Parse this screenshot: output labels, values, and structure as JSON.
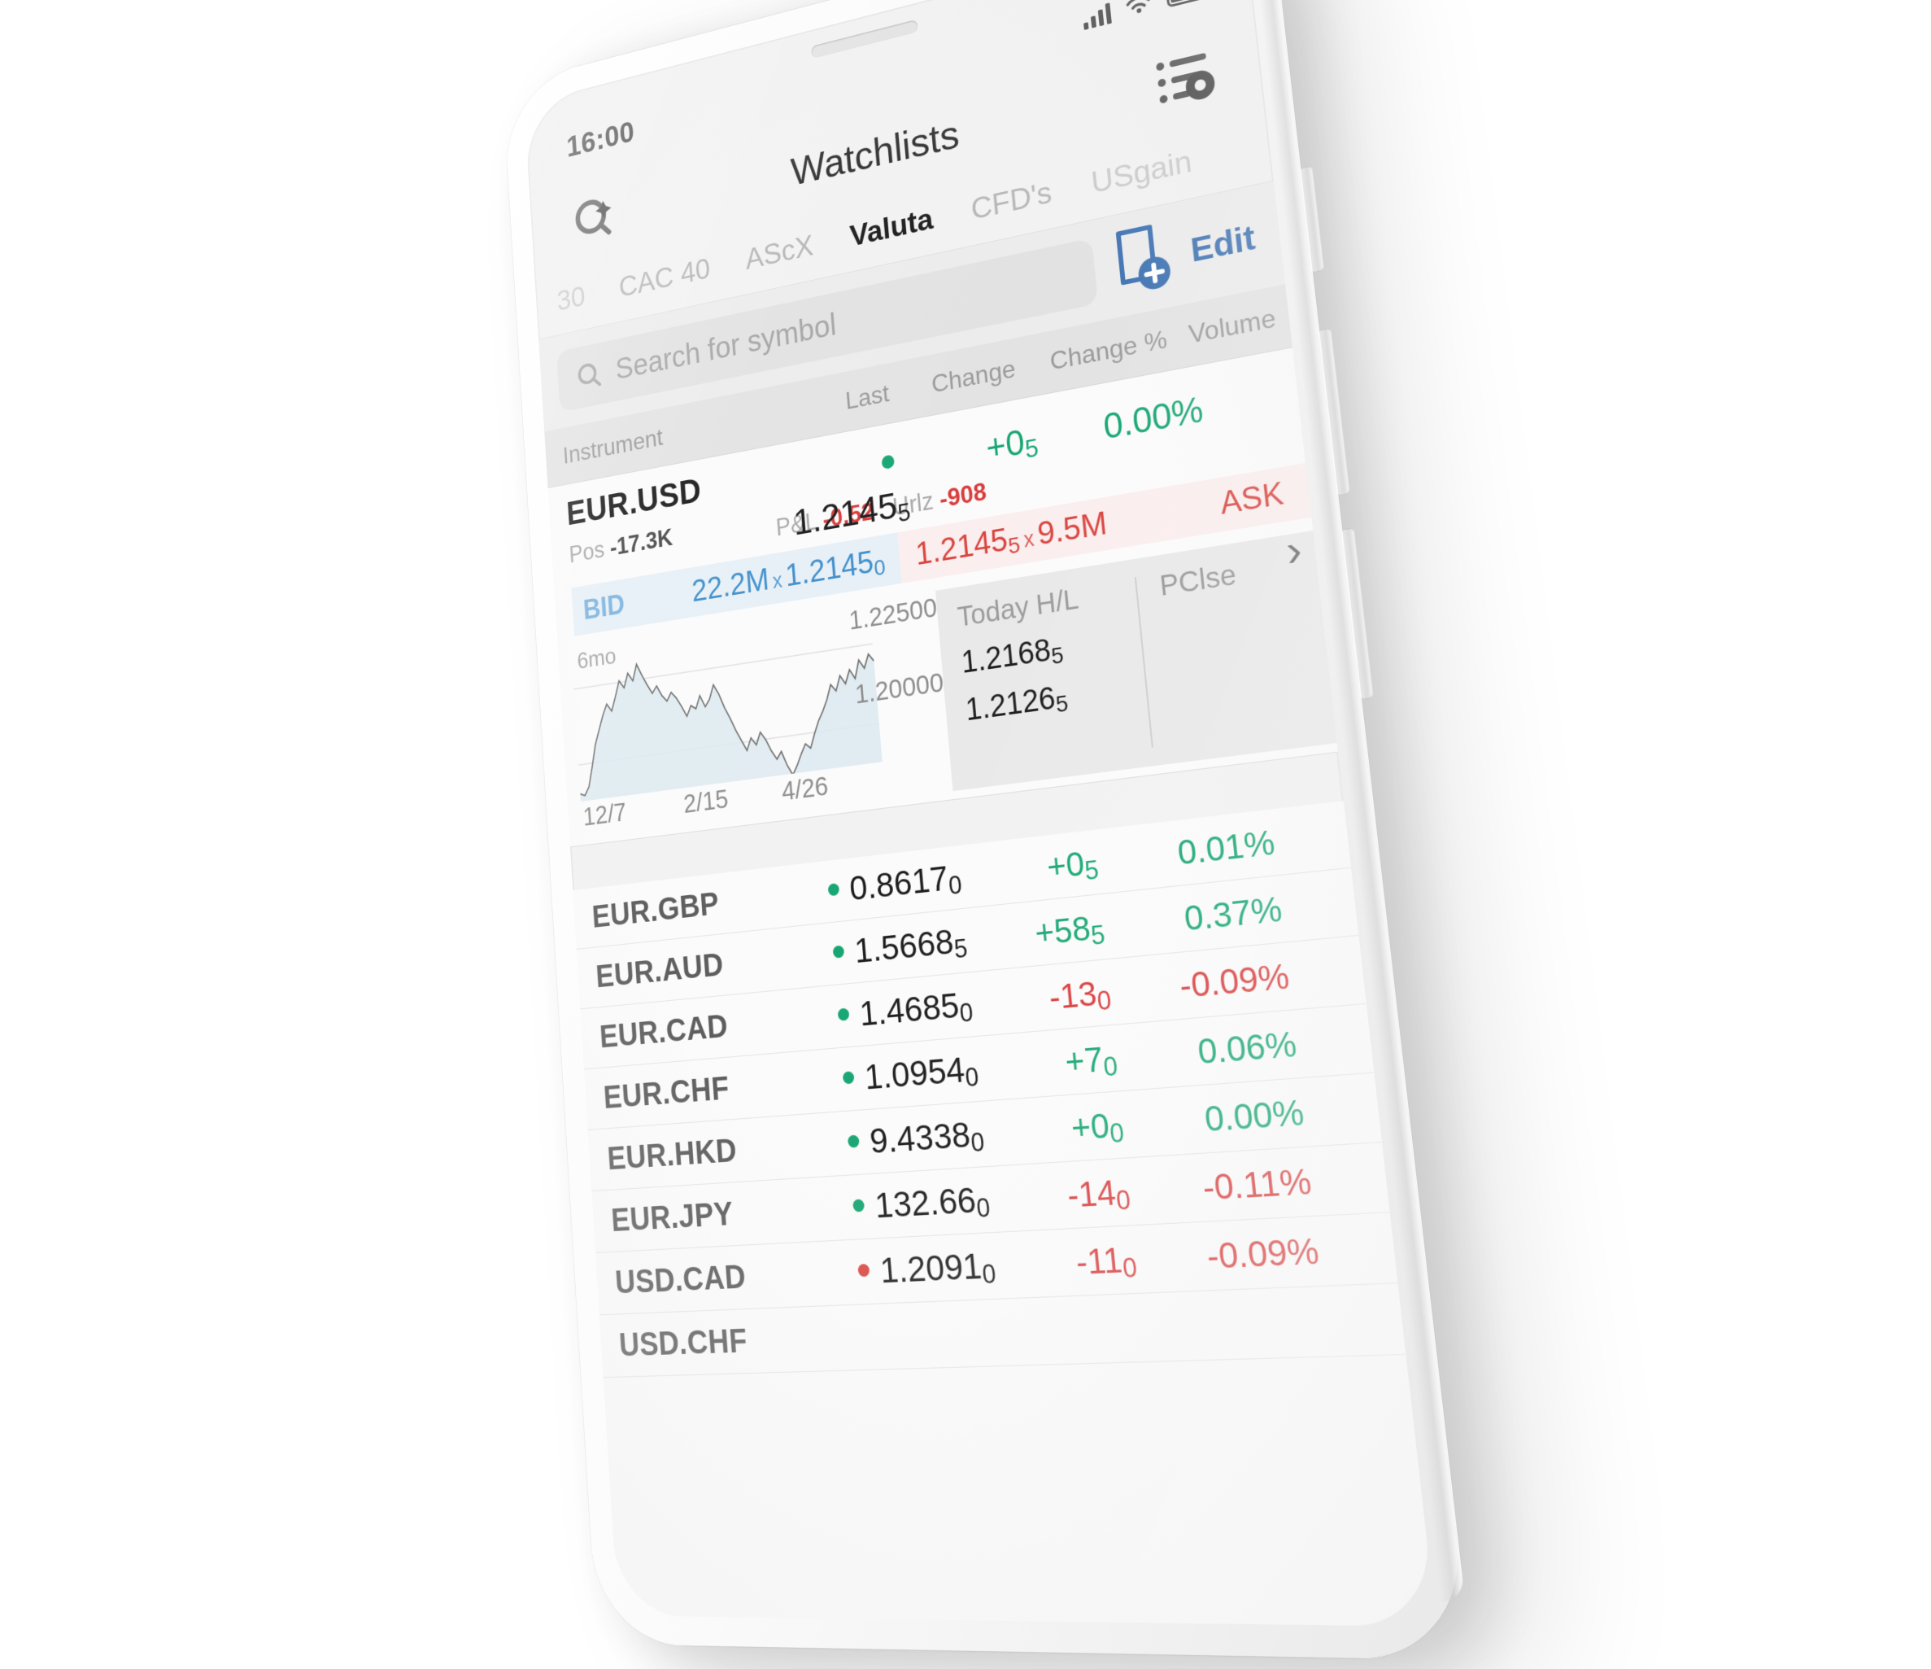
{
  "status_bar": {
    "time": "16:00",
    "signal_icon": "cellular-bars-icon",
    "wifi_icon": "wifi-icon",
    "battery_icon": "battery-full-icon"
  },
  "navbar": {
    "title": "Watchlists",
    "left_icon": "smart-search-icon",
    "right_icon": "watchlist-settings-icon"
  },
  "tabs": [
    {
      "label": "30",
      "active": false,
      "partial": true
    },
    {
      "label": "CAC 40",
      "active": false,
      "partial": false
    },
    {
      "label": "AScX",
      "active": false,
      "partial": false
    },
    {
      "label": "Valuta",
      "active": true,
      "partial": false
    },
    {
      "label": "CFD's",
      "active": false,
      "partial": false
    },
    {
      "label": "USgain",
      "active": false,
      "partial": true
    }
  ],
  "search": {
    "placeholder": "Search for symbol",
    "icon": "search-icon",
    "add_page_icon": "add-page-icon",
    "edit_label": "Edit"
  },
  "columns": {
    "instrument": "Instrument",
    "last": "Last",
    "change": "Change",
    "change_pct": "Change %",
    "volume": "Volume"
  },
  "expanded": {
    "symbol": "EUR.USD",
    "last_main": "1.2145",
    "last_sub": "5",
    "change": "+0",
    "change_sub": "5",
    "change_pct": "0.00%",
    "pos_label": "Pos",
    "pos_value": "-17.3K",
    "pnl_label": "P&L",
    "pnl_value": "-0.52",
    "urlz_label": "Urlz",
    "urlz_value": "-908",
    "bid_label": "BID",
    "bid_size": "22.2M",
    "bid_price_main": "1.2145",
    "bid_price_sub": "0",
    "ask_label": "ASK",
    "ask_price_main": "1.2145",
    "ask_price_sub": "5",
    "ask_size": "9.5M",
    "multiply_symbol": "x",
    "today_hl_label": "Today H/L",
    "today_high_main": "1.2168",
    "today_high_sub": "5",
    "today_low_main": "1.2126",
    "today_low_sub": "5",
    "pclse_label": "PClse",
    "pclse_value": "",
    "chevron_icon": "chevron-right-icon"
  },
  "chart_data": {
    "type": "area",
    "title": "",
    "range_label": "6mo",
    "xlabel": "",
    "ylabel": "",
    "x_ticks": [
      "12/7",
      "2/15",
      "4/26"
    ],
    "y_ticks": [
      "1.20000",
      "1.22500"
    ],
    "ylim": [
      1.188,
      1.234
    ],
    "grid": true,
    "legend": "none",
    "series": [
      {
        "name": "EUR.USD",
        "values": [
          1.1905,
          1.1898,
          1.1925,
          1.199,
          1.206,
          1.2105,
          1.215,
          1.2185,
          1.216,
          1.2205,
          1.2255,
          1.223,
          1.2275,
          1.2248,
          1.23,
          1.2262,
          1.2228,
          1.2198,
          1.222,
          1.2186,
          1.2166,
          1.2192,
          1.2172,
          1.2142,
          1.2108,
          1.214,
          1.2128,
          1.2168,
          1.213,
          1.2152,
          1.2196,
          1.2164,
          1.2118,
          1.2082,
          1.204,
          1.2006,
          1.1972,
          1.201,
          1.1986,
          1.2024,
          1.1998,
          1.196,
          1.1932,
          1.1954,
          1.1908,
          1.1876,
          1.1904,
          1.1938,
          1.1968,
          1.1952,
          1.1996,
          1.2034,
          1.2062,
          1.2096,
          1.2142,
          1.212,
          1.2166,
          1.2138,
          1.218,
          1.215,
          1.2206,
          1.2178,
          1.222,
          1.2196
        ]
      }
    ]
  },
  "rows": [
    {
      "symbol": "EUR.GBP",
      "dot": "green",
      "last_main": "0.8617",
      "last_sub": "0",
      "change": "+0",
      "change_sub": "5",
      "change_pct": "0.01%",
      "dir": "up"
    },
    {
      "symbol": "EUR.AUD",
      "dot": "green",
      "last_main": "1.5668",
      "last_sub": "5",
      "change": "+58",
      "change_sub": "5",
      "change_pct": "0.37%",
      "dir": "up"
    },
    {
      "symbol": "EUR.CAD",
      "dot": "green",
      "last_main": "1.4685",
      "last_sub": "0",
      "change": "-13",
      "change_sub": "0",
      "change_pct": "-0.09%",
      "dir": "down"
    },
    {
      "symbol": "EUR.CHF",
      "dot": "green",
      "last_main": "1.0954",
      "last_sub": "0",
      "change": "+7",
      "change_sub": "0",
      "change_pct": "0.06%",
      "dir": "up"
    },
    {
      "symbol": "EUR.HKD",
      "dot": "green",
      "last_main": "9.4338",
      "last_sub": "0",
      "change": "+0",
      "change_sub": "0",
      "change_pct": "0.00%",
      "dir": "up"
    },
    {
      "symbol": "EUR.JPY",
      "dot": "green",
      "last_main": "132.66",
      "last_sub": "0",
      "change": "-14",
      "change_sub": "0",
      "change_pct": "-0.11%",
      "dir": "down"
    },
    {
      "symbol": "USD.CAD",
      "dot": "red",
      "last_main": "1.2091",
      "last_sub": "0",
      "change": "-11",
      "change_sub": "0",
      "change_pct": "-0.09%",
      "dir": "down"
    },
    {
      "symbol": "USD.CHF",
      "dot": "red",
      "last_main": "",
      "last_sub": "",
      "change": "",
      "change_sub": "",
      "change_pct": "",
      "dir": "down"
    }
  ],
  "colors": {
    "up": "#17a673",
    "down": "#d9453f",
    "accent_blue": "#3a6fb0",
    "bid_blue": "#3f8ecb",
    "screen_bg": "#f2f2f2"
  }
}
